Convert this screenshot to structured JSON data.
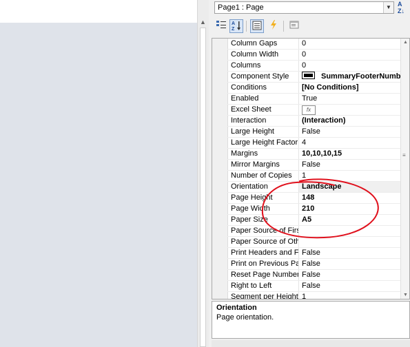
{
  "component_selector": {
    "value": "Page1 : Page"
  },
  "toolbar": {
    "categorized_icon": "categorized-icon",
    "alphabetical_icon": "alphabetical-sort-icon",
    "properties_icon": "properties-icon",
    "events_icon": "lightning-icon",
    "property_pages_icon": "property-pages-icon"
  },
  "properties": [
    {
      "name": "Column Gaps",
      "value": "0"
    },
    {
      "name": "Column Width",
      "value": "0"
    },
    {
      "name": "Columns",
      "value": "0"
    },
    {
      "name": "Component Style",
      "value": "SummaryFooterNumb",
      "bold": true,
      "swatch": true
    },
    {
      "name": "Conditions",
      "value": "[No Conditions]",
      "bold": true
    },
    {
      "name": "Enabled",
      "value": "True"
    },
    {
      "name": "Excel Sheet",
      "value": "",
      "fx": true
    },
    {
      "name": "Interaction",
      "value": "(Interaction)",
      "bold": true
    },
    {
      "name": "Large Height",
      "value": "False"
    },
    {
      "name": "Large Height Factor",
      "value": "4"
    },
    {
      "name": "Margins",
      "value": "10,10,10,15",
      "bold": true
    },
    {
      "name": "Mirror Margins",
      "value": "False"
    },
    {
      "name": "Number of Copies",
      "value": "1"
    },
    {
      "name": "Orientation",
      "value": "Landscape",
      "bold": true,
      "selected": true
    },
    {
      "name": "Page Height",
      "value": "148",
      "bold": true
    },
    {
      "name": "Page Width",
      "value": "210",
      "bold": true
    },
    {
      "name": "Paper Size",
      "value": "A5",
      "bold": true
    },
    {
      "name": "Paper Source of Firs",
      "value": ""
    },
    {
      "name": "Paper Source of Oth",
      "value": ""
    },
    {
      "name": "Print Headers and Fo",
      "value": "False"
    },
    {
      "name": "Print on Previous Pag",
      "value": "False"
    },
    {
      "name": "Reset Page Number",
      "value": "False"
    },
    {
      "name": "Right to Left",
      "value": "False"
    },
    {
      "name": "Segment per Height",
      "value": "1"
    }
  ],
  "description": {
    "title": "Orientation",
    "text": "Page orientation."
  },
  "colors": {
    "annotation": "#e0101c",
    "canvas_background": "#dfe3ea",
    "selected_row": "#f0f0f0"
  }
}
